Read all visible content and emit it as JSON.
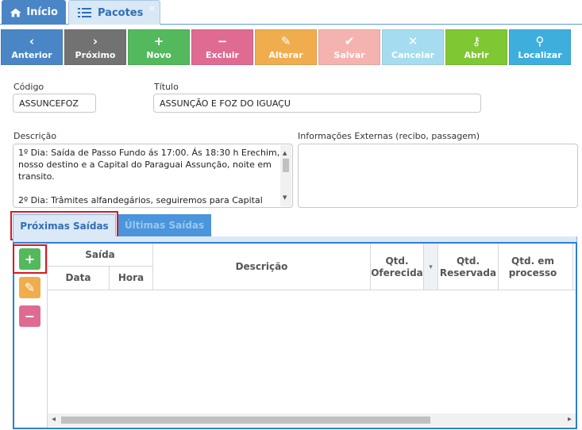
{
  "tabs": [
    {
      "label": "Início",
      "icon": "home-icon"
    },
    {
      "label": "Pacotes",
      "icon": "list-icon",
      "close": "×"
    }
  ],
  "toolbar": [
    {
      "label": "Anterior",
      "icon": "‹",
      "color": "#4a86c5"
    },
    {
      "label": "Próximo",
      "icon": "›",
      "color": "#727272"
    },
    {
      "label": "Novo",
      "icon": "+",
      "color": "#53b95c"
    },
    {
      "label": "Excluir",
      "icon": "−",
      "color": "#df6b93"
    },
    {
      "label": "Alterar",
      "icon": "✎",
      "color": "#f0ad4e"
    },
    {
      "label": "Salvar",
      "icon": "✔",
      "color": "#f5b3b0"
    },
    {
      "label": "Cancelar",
      "icon": "✕",
      "color": "#a6dcef"
    },
    {
      "label": "Abrir",
      "icon": "⚷",
      "color": "#7fc733"
    },
    {
      "label": "Localizar",
      "icon": "⚲",
      "color": "#3eaedd"
    }
  ],
  "form": {
    "codigo_label": "Código",
    "codigo_value": "ASSUNCEFOZ",
    "titulo_label": "Título",
    "titulo_value": "ASSUNÇÃO E FOZ DO IGUAÇU",
    "descricao_label": "Descrição",
    "descricao_lines": [
      "1º Dia: Saída de Passo Fundo ás 17:00. Ás 18:30 h Erechim,",
      "nosso destino e a Capital do Paraguai Assunção, noite em",
      "transito.",
      "",
      "2º Dia: Trâmites alfandegários, seguiremos para Capital"
    ],
    "info_label": "Informações Externas (recibo, passagem)"
  },
  "subtabs": {
    "proximas": "Próximas Saídas",
    "ultimas": "Últimas Saídas"
  },
  "grid": {
    "saida": "Saída",
    "data": "Data",
    "hora": "Hora",
    "descricao": "Descrição",
    "qtd_oferecida": "Qtd. Oferecida",
    "qtd_reservada": "Qtd. Reservada",
    "qtd_processo": "Qtd. em processo"
  },
  "side_buttons": [
    {
      "icon": "+",
      "color": "#53b95c"
    },
    {
      "icon": "✎",
      "color": "#f0ad4e"
    },
    {
      "icon": "−",
      "color": "#df6b93"
    }
  ],
  "scroll": {
    "left": "◂",
    "right": "▸",
    "up": "▲",
    "down": "▼",
    "sort": "▾"
  }
}
